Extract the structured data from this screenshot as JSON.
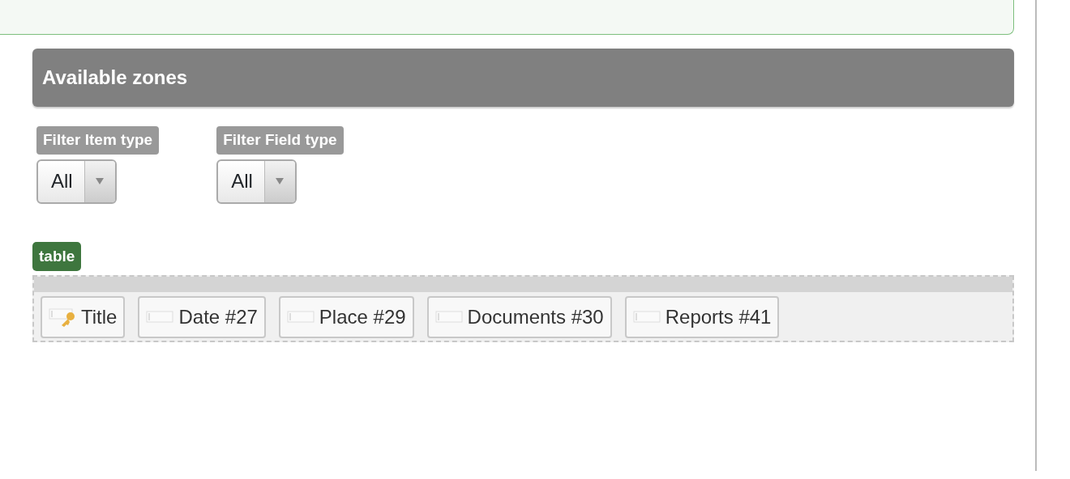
{
  "section": {
    "title": "Available zones"
  },
  "filters": [
    {
      "label": "Filter Item type",
      "value": "All"
    },
    {
      "label": "Filter Field type",
      "value": "All"
    }
  ],
  "zone": {
    "tag": "table",
    "items": [
      {
        "label": "Title",
        "kind": "key"
      },
      {
        "label": "Date #27",
        "kind": "field"
      },
      {
        "label": "Place #29",
        "kind": "field"
      },
      {
        "label": "Documents #30",
        "kind": "field"
      },
      {
        "label": "Reports #41",
        "kind": "field"
      }
    ]
  }
}
